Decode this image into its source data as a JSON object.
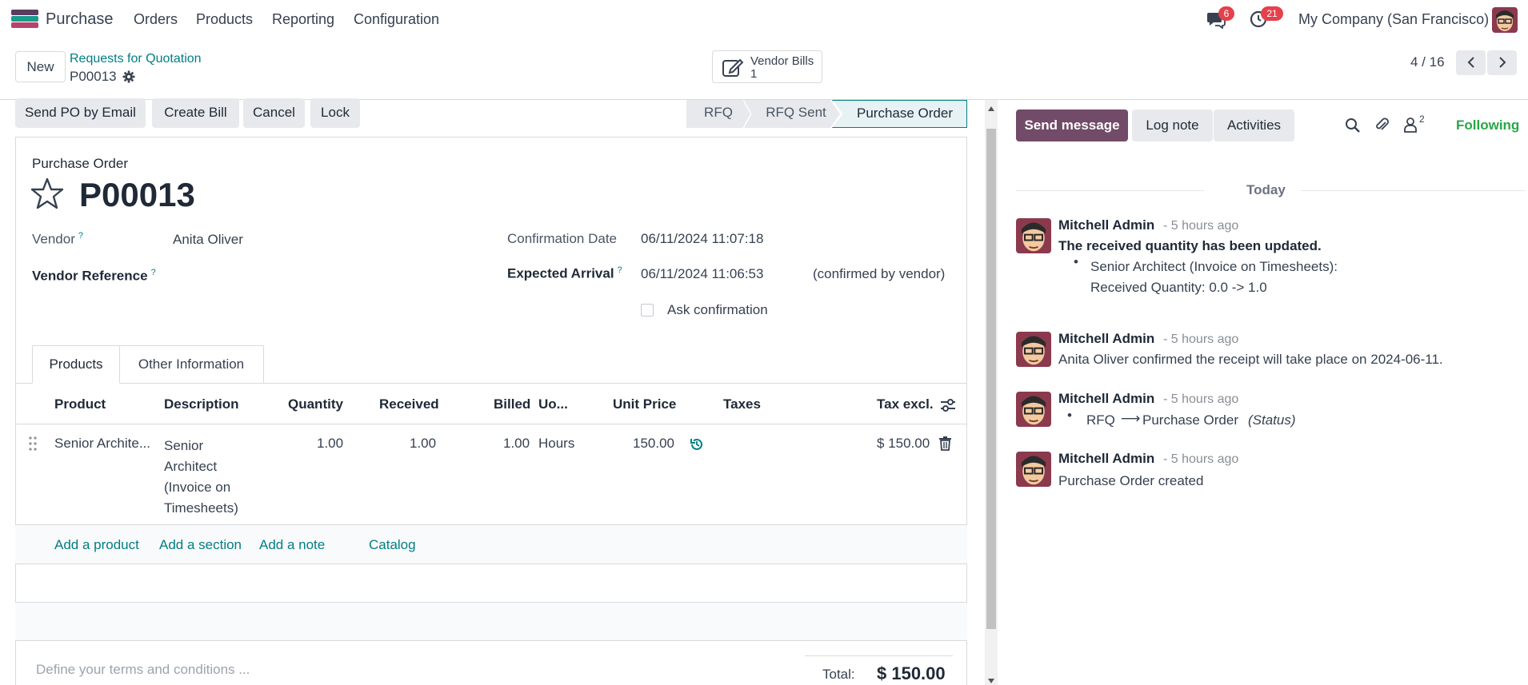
{
  "nav": {
    "app_name": "Purchase",
    "menu": [
      "Orders",
      "Products",
      "Reporting",
      "Configuration"
    ],
    "messages_count": "6",
    "activities_count": "21",
    "company": "My Company (San Francisco)"
  },
  "control": {
    "new_label": "New",
    "breadcrumb_parent": "Requests for Quotation",
    "record_name": "P00013",
    "smart_button": {
      "title": "Vendor Bills",
      "count": "1"
    },
    "pager": "4 / 16"
  },
  "actions": {
    "send_po": "Send PO by Email",
    "create_bill": "Create Bill",
    "cancel": "Cancel",
    "lock": "Lock"
  },
  "status": {
    "stages": [
      "RFQ",
      "RFQ Sent",
      "Purchase Order"
    ],
    "current": "Purchase Order"
  },
  "form": {
    "doc_type": "Purchase Order",
    "name": "P00013",
    "vendor_label": "Vendor",
    "vendor_value": "Anita Oliver",
    "vendor_ref_label": "Vendor Reference",
    "confirmation_date_label": "Confirmation Date",
    "confirmation_date_value": "06/11/2024 11:07:18",
    "expected_arrival_label": "Expected Arrival",
    "expected_arrival_value": "06/11/2024 11:06:53",
    "confirmed_note": "(confirmed by vendor)",
    "ask_confirmation_label": "Ask confirmation",
    "help_mark": "?",
    "tabs": [
      "Products",
      "Other Information"
    ],
    "columns": [
      "Product",
      "Description",
      "Quantity",
      "Received",
      "Billed",
      "Uo...",
      "Unit Price",
      "Taxes",
      "Tax excl."
    ],
    "lines": [
      {
        "product": "Senior Archite...",
        "description": [
          "Senior",
          "Architect",
          "(Invoice on",
          "Timesheets)"
        ],
        "quantity": "1.00",
        "received": "1.00",
        "billed": "1.00",
        "uom": "Hours",
        "unit_price": "150.00",
        "taxes": "",
        "subtotal": "$ 150.00"
      }
    ],
    "add_links": [
      "Add a product",
      "Add a section",
      "Add a note",
      "Catalog"
    ],
    "terms_placeholder": "Define your terms and conditions ...",
    "total_label": "Total:",
    "total_value": "$ 150.00"
  },
  "chatter": {
    "send_message": "Send message",
    "log_note": "Log note",
    "activities": "Activities",
    "followers_count": "2",
    "following": "Following",
    "date_separator": "Today",
    "messages": [
      {
        "author": "Mitchell Admin",
        "time": "- 5 hours ago",
        "title": "The received quantity has been updated.",
        "line1": "Senior Architect (Invoice on Timesheets):",
        "line2": "Received Quantity: 0.0 -> 1.0"
      },
      {
        "author": "Mitchell Admin",
        "time": "- 5 hours ago",
        "body": "Anita Oliver confirmed the receipt will take place on 2024-06-11."
      },
      {
        "author": "Mitchell Admin",
        "time": "- 5 hours ago",
        "old": "RFQ",
        "arrow": "⟶",
        "new": "Purchase Order",
        "field": "(Status)"
      },
      {
        "author": "Mitchell Admin",
        "time": "- 5 hours ago",
        "body": "Purchase Order created"
      }
    ]
  },
  "colors": {
    "brand": "#714b67",
    "link": "#017e84",
    "badge": "#e4414b",
    "following": "#28a745"
  }
}
